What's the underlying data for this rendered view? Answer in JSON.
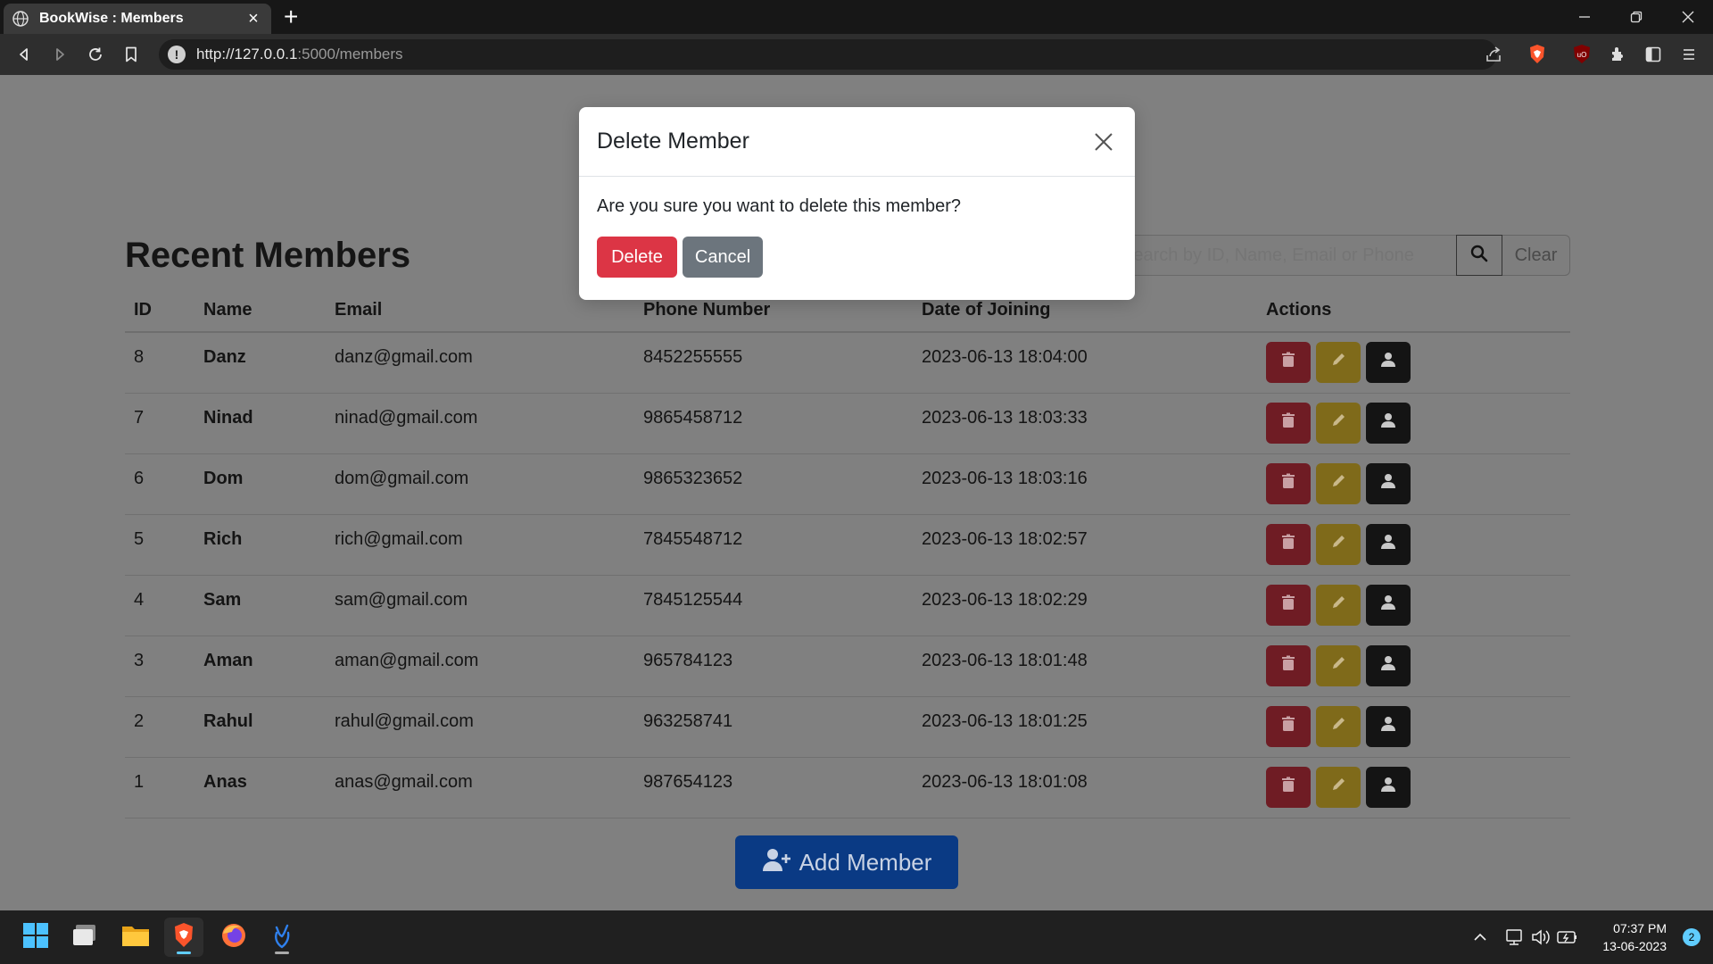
{
  "browser": {
    "tab_title": "BookWise : Members",
    "url_host": "http://127.0.0.1",
    "url_rest": ":5000/members"
  },
  "page": {
    "title": "Recent Members",
    "search_placeholder": "Search by ID, Name, Email or Phone",
    "clear_label": "Clear",
    "add_member_label": "Add Member"
  },
  "table": {
    "headers": [
      "ID",
      "Name",
      "Email",
      "Phone Number",
      "Date of Joining",
      "Actions"
    ],
    "rows": [
      {
        "id": "8",
        "name": "Danz",
        "email": "danz@gmail.com",
        "phone": "8452255555",
        "date": "2023-06-13 18:04:00"
      },
      {
        "id": "7",
        "name": "Ninad",
        "email": "ninad@gmail.com",
        "phone": "9865458712",
        "date": "2023-06-13 18:03:33"
      },
      {
        "id": "6",
        "name": "Dom",
        "email": "dom@gmail.com",
        "phone": "9865323652",
        "date": "2023-06-13 18:03:16"
      },
      {
        "id": "5",
        "name": "Rich",
        "email": "rich@gmail.com",
        "phone": "7845548712",
        "date": "2023-06-13 18:02:57"
      },
      {
        "id": "4",
        "name": "Sam",
        "email": "sam@gmail.com",
        "phone": "7845125544",
        "date": "2023-06-13 18:02:29"
      },
      {
        "id": "3",
        "name": "Aman",
        "email": "aman@gmail.com",
        "phone": "965784123",
        "date": "2023-06-13 18:01:48"
      },
      {
        "id": "2",
        "name": "Rahul",
        "email": "rahul@gmail.com",
        "phone": "963258741",
        "date": "2023-06-13 18:01:25"
      },
      {
        "id": "1",
        "name": "Anas",
        "email": "anas@gmail.com",
        "phone": "987654123",
        "date": "2023-06-13 18:01:08"
      }
    ]
  },
  "modal": {
    "title": "Delete Member",
    "message": "Are you sure you want to delete this member?",
    "delete_label": "Delete",
    "cancel_label": "Cancel"
  },
  "taskbar": {
    "time": "07:37 PM",
    "date": "13-06-2023",
    "notification_count": "2"
  },
  "colors": {
    "danger": "#dc3545",
    "secondary": "#6c757d",
    "primary": "#0d6efd",
    "warning": "#ffc107",
    "overlay": "#808080"
  }
}
